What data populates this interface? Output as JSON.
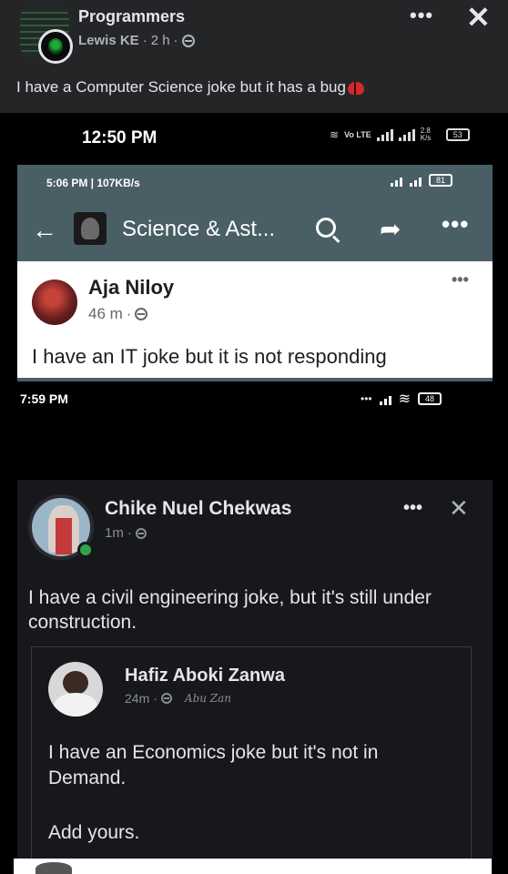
{
  "post": {
    "group_name": "Programmers",
    "author": "Lewis KE",
    "time": "2 h",
    "caption": "I have a Computer Science joke but it has a bug"
  },
  "screenshot": {
    "status_time": "12:50 PM",
    "status_network": "Vo LTE",
    "status_speed": "2.8 K/s",
    "battery": "53",
    "inner1": {
      "status_time": "5:06 PM | 107KB/s",
      "battery": "81",
      "appbar_title": "Science & Ast...",
      "post": {
        "name": "Aja Niloy",
        "time": "46 m",
        "text": "I have an IT joke but it is not responding"
      }
    },
    "status2_time": "7:59 PM",
    "status2_battery": "48",
    "inner2": {
      "post": {
        "name": "Chike Nuel Chekwas",
        "time": "1m",
        "text": "I have a civil engineering joke, but it's still under construction."
      },
      "shared": {
        "name": "Hafiz Aboki Zanwa",
        "time": "24m",
        "signature": "Abu Zan",
        "text": "I have an Economics joke but it's not in Demand.",
        "add_yours": "Add yours."
      }
    }
  },
  "colors": {
    "fb_dark_bg": "#242526",
    "appbar": "#4a5e66",
    "dark_card": "#17181c",
    "online": "#31a24c"
  },
  "icons": [
    "globe-icon",
    "more-icon",
    "close-icon",
    "bug-emoji-icon",
    "back-arrow-icon",
    "search-icon",
    "share-icon",
    "signal-icon",
    "battery-icon"
  ]
}
